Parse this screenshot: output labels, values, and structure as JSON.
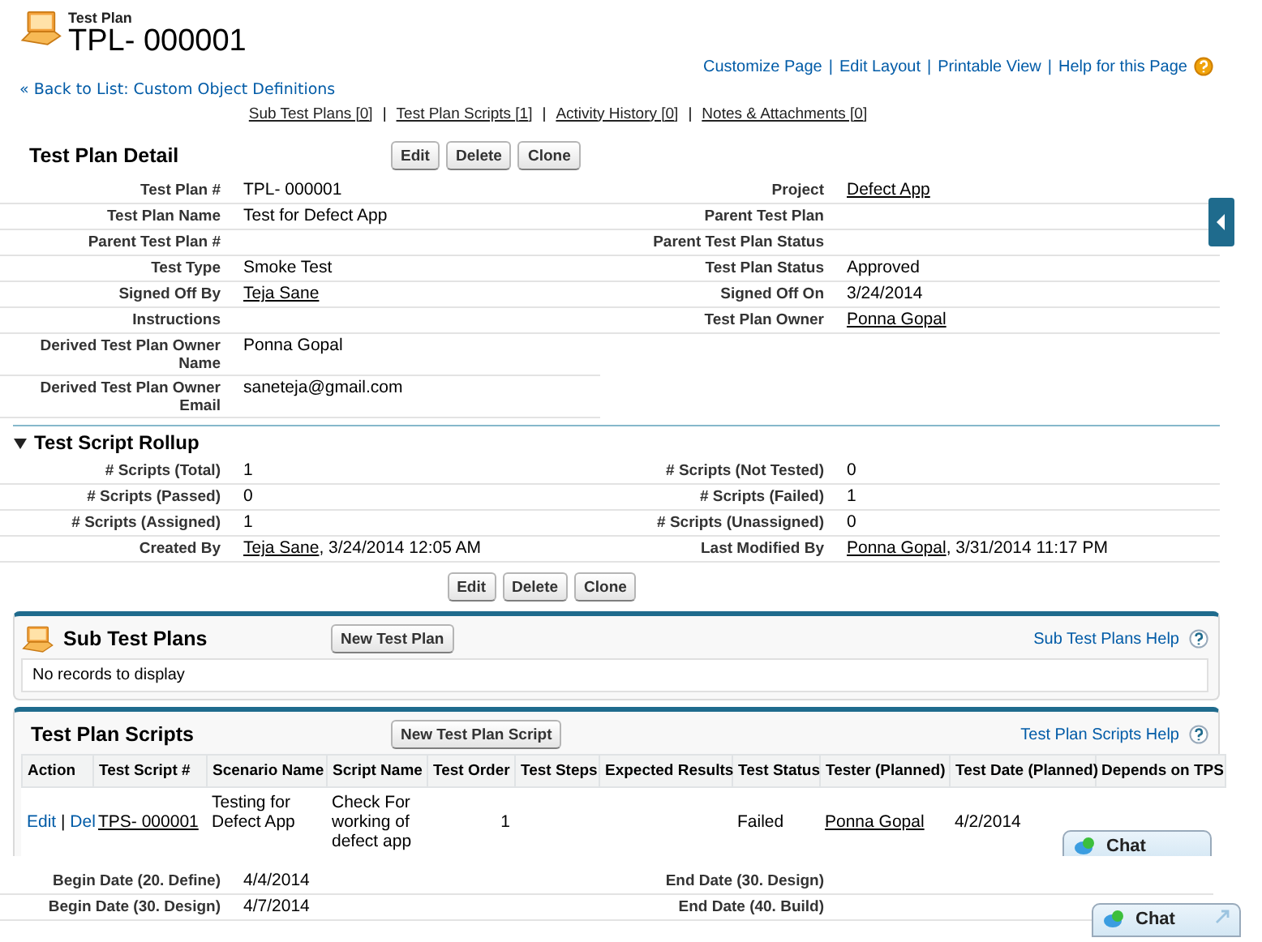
{
  "header": {
    "object_type": "Test Plan",
    "title": "TPL- 000001"
  },
  "top_links": {
    "separator": "|",
    "items": [
      "Customize Page",
      "Edit Layout",
      "Printable View",
      "Help for this Page"
    ]
  },
  "back_link": "« Back to List: Custom Object Definitions",
  "related_links": {
    "separator": "|",
    "items": [
      "Sub Test Plans [0]",
      "Test Plan Scripts [1]",
      "Activity History [0]",
      "Notes & Attachments [0]"
    ]
  },
  "detail": {
    "title": "Test Plan Detail",
    "buttons": [
      "Edit",
      "Delete",
      "Clone"
    ],
    "rows": [
      {
        "left": {
          "label": "Test Plan #",
          "value": "TPL- 000001",
          "kind": "text"
        },
        "right": {
          "label": "Project",
          "value": "Defect App",
          "kind": "link"
        }
      },
      {
        "left": {
          "label": "Test Plan Name",
          "value": "Test for Defect App",
          "kind": "text"
        },
        "right": {
          "label": "Parent Test Plan"
        }
      },
      {
        "left": {
          "label": "Parent Test Plan #"
        },
        "right": {
          "label": "Parent Test Plan Status"
        }
      },
      {
        "left": {
          "label": "Test Type",
          "value": "Smoke Test",
          "kind": "text"
        },
        "right": {
          "label": "Test Plan Status",
          "value": "Approved",
          "kind": "text"
        }
      },
      {
        "left": {
          "label": "Signed Off By",
          "value": "Teja Sane",
          "kind": "link"
        },
        "right": {
          "label": "Signed Off On",
          "value": "3/24/2014",
          "kind": "text"
        }
      },
      {
        "left": {
          "label": "Instructions"
        },
        "right": {
          "label": "Test Plan Owner",
          "value": "Ponna Gopal",
          "kind": "link"
        }
      },
      {
        "left": {
          "label": "Derived Test Plan Owner Name",
          "value": "Ponna Gopal",
          "kind": "text"
        }
      },
      {
        "left": {
          "label": "Derived Test Plan Owner Email",
          "value": "saneteja@gmail.com",
          "kind": "text"
        }
      }
    ]
  },
  "rollup": {
    "title": "Test Script Rollup",
    "expanded": true,
    "rows": [
      {
        "left": {
          "label": "# Scripts (Total)",
          "value": "1",
          "kind": "text"
        },
        "right": {
          "label": "# Scripts (Not Tested)",
          "value": "0",
          "kind": "text"
        }
      },
      {
        "left": {
          "label": "# Scripts (Passed)",
          "value": "0",
          "kind": "text"
        },
        "right": {
          "label": "# Scripts (Failed)",
          "value": "1",
          "kind": "text"
        }
      },
      {
        "left": {
          "label": "# Scripts (Assigned)",
          "value": "1",
          "kind": "text"
        },
        "right": {
          "label": "# Scripts (Unassigned)",
          "value": "0",
          "kind": "text"
        }
      },
      {
        "left": {
          "label": "Created By",
          "value": "Teja Sane",
          "kind": "link",
          "suffix": ", 3/24/2014 12:05 AM"
        },
        "right": {
          "label": "Last Modified By",
          "value": "Ponna Gopal",
          "kind": "link",
          "suffix": ", 3/31/2014 11:17 PM"
        }
      }
    ]
  },
  "bottom_buttons": [
    "Edit",
    "Delete",
    "Clone"
  ],
  "sub_test_plans": {
    "title": "Sub Test Plans",
    "button": "New Test Plan",
    "help": "Sub Test Plans Help",
    "empty": "No records to display"
  },
  "test_plan_scripts": {
    "title": "Test Plan Scripts",
    "button": "New Test Plan Script",
    "help": "Test Plan Scripts Help",
    "columns": [
      "Action",
      "Test Script #",
      "Scenario Name",
      "Script Name",
      "Test Order",
      "Test Steps",
      "Expected Results",
      "Test Status",
      "Tester (Planned)",
      "Test Date (Planned)",
      "Depends on TPS"
    ],
    "rows": [
      {
        "cells": [
          {
            "kind": "actions",
            "links": [
              "Edit",
              "Del"
            ],
            "separator": "|"
          },
          {
            "kind": "link",
            "text": "TPS- 000001"
          },
          {
            "kind": "text",
            "text": "Testing for Defect App"
          },
          {
            "kind": "text",
            "text": "Check For working of defect app"
          },
          {
            "kind": "number",
            "text": "1"
          },
          {
            "kind": "blank"
          },
          {
            "kind": "blank"
          },
          {
            "kind": "text",
            "text": "Failed"
          },
          {
            "kind": "link",
            "text": "Ponna Gopal"
          },
          {
            "kind": "text",
            "text": "4/2/2014"
          },
          {
            "kind": "blank"
          }
        ]
      }
    ]
  },
  "extra_rows": [
    {
      "left": {
        "label": "Begin Date (20. Define)",
        "value": "4/4/2014",
        "kind": "text"
      },
      "right": {
        "label": "End Date (30. Design)"
      }
    },
    {
      "left": {
        "label": "Begin Date (30. Design)",
        "value": "4/7/2014",
        "kind": "text"
      },
      "right": {
        "label": "End Date (40. Build)"
      }
    }
  ],
  "chat_widgets": [
    "Chat",
    "Chat"
  ]
}
